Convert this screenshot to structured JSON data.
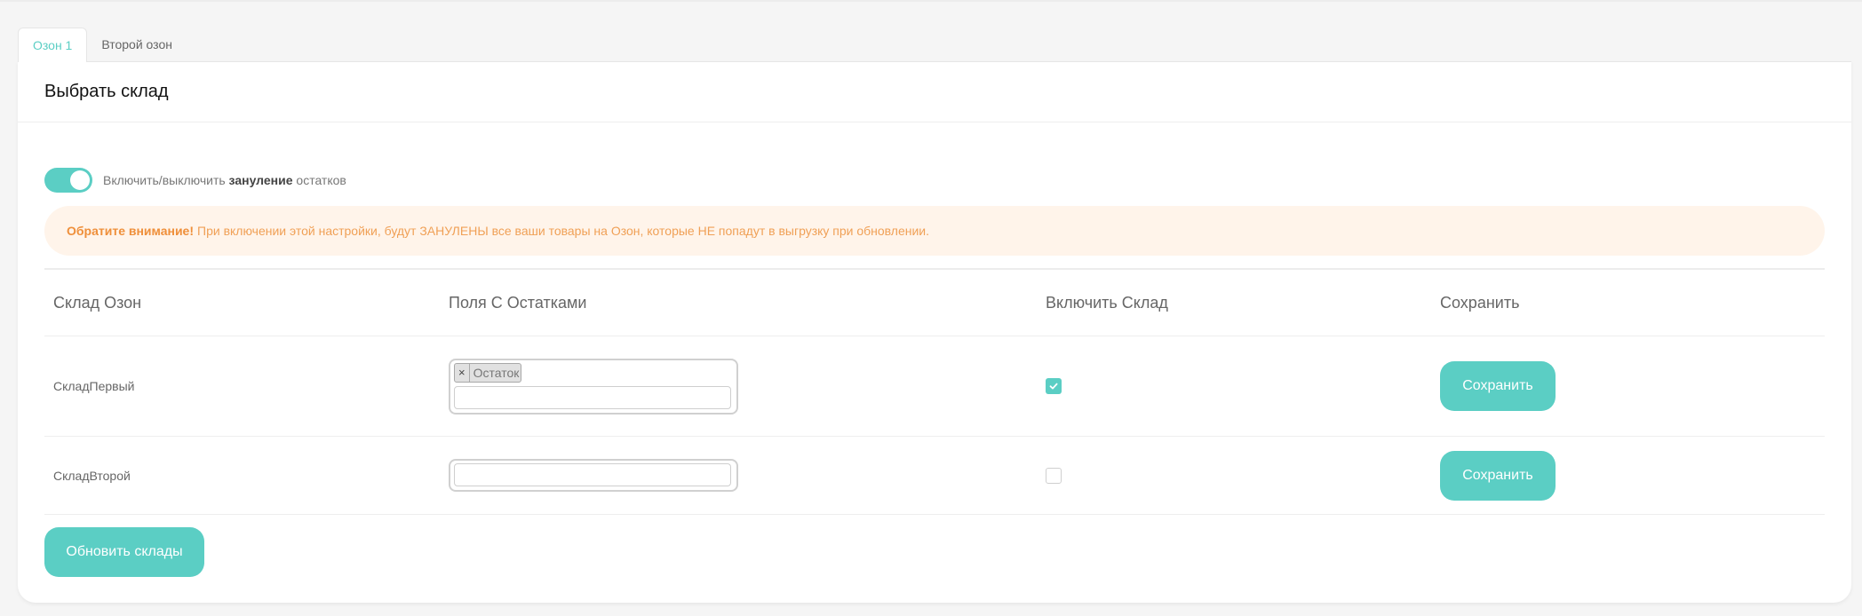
{
  "tabs": [
    {
      "label": "Озон 1",
      "active": true
    },
    {
      "label": "Второй озон",
      "active": false
    }
  ],
  "card": {
    "title": "Выбрать склад"
  },
  "toggle": {
    "on": true,
    "label_prefix": "Включить/выключить",
    "label_bold": "зануление",
    "label_suffix": "остатков"
  },
  "alert": {
    "bold": "Обратите внимание!",
    "text": "При включении этой настройки, будут ЗАНУЛЕНЫ все ваши товары на Озон, которые НЕ попадут в выгрузку при обновлении."
  },
  "table": {
    "headers": [
      "Склад Озон",
      "Поля С Остатками",
      "Включить Склад",
      "Сохранить"
    ],
    "rows": [
      {
        "warehouse": "СкладПервый",
        "fields": [
          "Остаток"
        ],
        "enabled": true,
        "save_label": "Сохранить"
      },
      {
        "warehouse": "СкладВторой",
        "fields": [],
        "enabled": false,
        "save_label": "Сохранить"
      }
    ]
  },
  "refresh_button": "Обновить склады",
  "colors": {
    "accent": "#5bcec4",
    "alert_bg": "#fff4ea",
    "alert_text": "#f0a056"
  }
}
